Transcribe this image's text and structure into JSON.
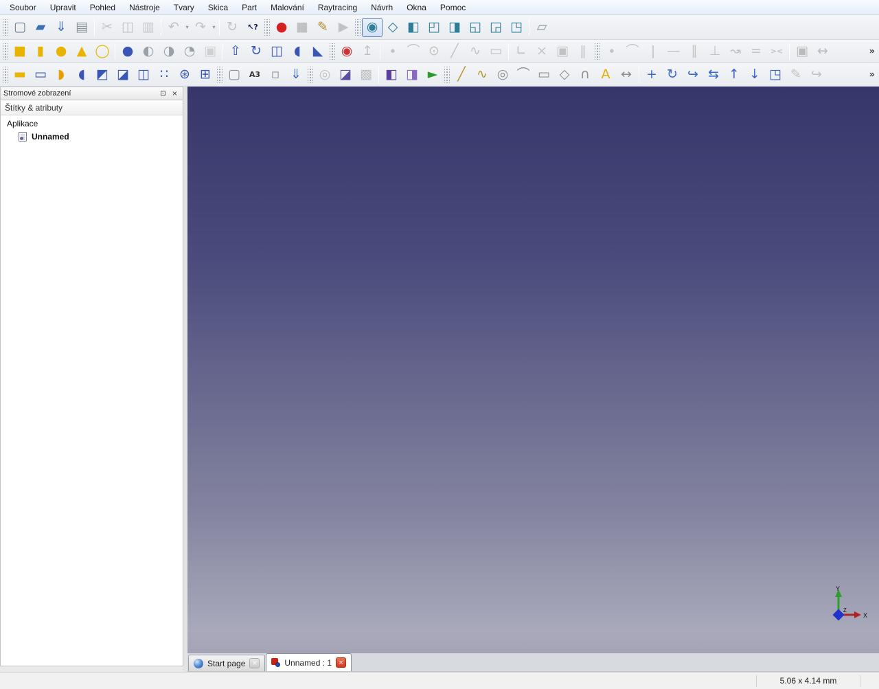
{
  "menu": {
    "items": [
      "Soubor",
      "Upravit",
      "Pohled",
      "Nástroje",
      "Tvary",
      "Skica",
      "Part",
      "Malování",
      "Raytracing",
      "Návrh",
      "Okna",
      "Pomoc"
    ]
  },
  "toolbars": {
    "row1": {
      "overflow": "",
      "groups": [
        {
          "lead": "handle",
          "items": [
            {
              "name": "new-document",
              "glyph": "▢",
              "color": "#6b7b8c"
            },
            {
              "name": "open-document",
              "glyph": "▰",
              "color": "#3f6fb5"
            },
            {
              "name": "save-document",
              "glyph": "⇓",
              "color": "#3f6fb5"
            },
            {
              "name": "print-document",
              "glyph": "▤",
              "color": "#8a929c"
            }
          ]
        },
        {
          "lead": "sep",
          "items": [
            {
              "name": "cut",
              "glyph": "✂",
              "color": "#777",
              "disabled": true
            },
            {
              "name": "copy",
              "glyph": "◫",
              "color": "#777",
              "disabled": true
            },
            {
              "name": "paste",
              "glyph": "▥",
              "color": "#9a8468",
              "disabled": true
            }
          ]
        },
        {
          "lead": "sep",
          "items": [
            {
              "name": "undo",
              "glyph": "↶",
              "color": "#777",
              "disabled": true,
              "caret": true
            },
            {
              "name": "redo",
              "glyph": "↷",
              "color": "#777",
              "disabled": true,
              "caret": true
            }
          ]
        },
        {
          "lead": "sep",
          "items": [
            {
              "name": "refresh",
              "glyph": "↻",
              "color": "#777",
              "disabled": true
            },
            {
              "name": "whats-this",
              "glyph": "↖?",
              "color": "#101a50",
              "small": true
            }
          ]
        },
        {
          "lead": "handle",
          "items": [
            {
              "name": "macro-record",
              "glyph": "●",
              "color": "#d42020"
            },
            {
              "name": "macro-stop",
              "glyph": "■",
              "color": "#777",
              "disabled": true
            },
            {
              "name": "macro-edit",
              "glyph": "✎",
              "color": "#b58a2a"
            },
            {
              "name": "macro-execute",
              "glyph": "▶",
              "color": "#777",
              "disabled": true
            }
          ]
        },
        {
          "lead": "handle",
          "items": [
            {
              "name": "view-fit-all",
              "glyph": "◉",
              "color": "#2e7d96",
              "selected": true
            },
            {
              "name": "view-axonometric",
              "glyph": "◇",
              "color": "#2e7d96"
            },
            {
              "name": "view-front",
              "glyph": "◧",
              "color": "#2e7d96"
            },
            {
              "name": "view-top",
              "glyph": "◰",
              "color": "#2e7d96"
            },
            {
              "name": "view-right",
              "glyph": "◨",
              "color": "#2e7d96"
            },
            {
              "name": "view-rear",
              "glyph": "◱",
              "color": "#2e7d96"
            },
            {
              "name": "view-bottom",
              "glyph": "◲",
              "color": "#2e7d96"
            },
            {
              "name": "view-left",
              "glyph": "◳",
              "color": "#2e7d96"
            }
          ]
        },
        {
          "lead": "sep",
          "items": [
            {
              "name": "measure-distance",
              "glyph": "▱",
              "color": "#8a929c"
            }
          ]
        }
      ]
    },
    "row2": {
      "overflow": "»",
      "groups": [
        {
          "lead": "handle",
          "items": [
            {
              "name": "part-box",
              "glyph": "■",
              "color": "#e8b400"
            },
            {
              "name": "part-cylinder",
              "glyph": "▮",
              "color": "#e8b400"
            },
            {
              "name": "part-sphere",
              "glyph": "●",
              "color": "#e8b400"
            },
            {
              "name": "part-cone",
              "glyph": "▲",
              "color": "#e8b400"
            },
            {
              "name": "part-torus",
              "glyph": "◯",
              "color": "#e8b400"
            }
          ]
        },
        {
          "lead": "sep",
          "items": [
            {
              "name": "boolean-union",
              "glyph": "●",
              "color": "#3a56b4"
            },
            {
              "name": "boolean-common",
              "glyph": "◐",
              "color": "#9aa0a8"
            },
            {
              "name": "boolean-cut",
              "glyph": "◑",
              "color": "#9aa0a8"
            },
            {
              "name": "boolean-intersection",
              "glyph": "◔",
              "color": "#9aa0a8"
            },
            {
              "name": "part-section",
              "glyph": "▣",
              "color": "#9aa0a8",
              "disabled": true
            }
          ]
        },
        {
          "lead": "sep",
          "items": [
            {
              "name": "part-extrude",
              "glyph": "⇧",
              "color": "#3a56b4"
            },
            {
              "name": "part-revolve",
              "glyph": "↻",
              "color": "#3a56b4"
            },
            {
              "name": "part-mirror",
              "glyph": "◫",
              "color": "#3a56b4"
            },
            {
              "name": "part-fillet",
              "glyph": "◖",
              "color": "#3a56b4"
            },
            {
              "name": "part-chamfer",
              "glyph": "◣",
              "color": "#3a56b4"
            }
          ]
        },
        {
          "lead": "handle",
          "items": [
            {
              "name": "sketch-new",
              "glyph": "◉",
              "color": "#cc3333"
            },
            {
              "name": "sketch-leave",
              "glyph": "↥",
              "color": "#777",
              "disabled": true
            }
          ]
        },
        {
          "lead": "sep",
          "items": [
            {
              "name": "sketch-point",
              "glyph": "∙",
              "color": "#777",
              "disabled": true
            },
            {
              "name": "sketch-arc",
              "glyph": "⌒",
              "color": "#777",
              "disabled": true
            },
            {
              "name": "sketch-circle",
              "glyph": "⊙",
              "color": "#777",
              "disabled": true
            },
            {
              "name": "sketch-line",
              "glyph": "╱",
              "color": "#777",
              "disabled": true
            },
            {
              "name": "sketch-polyline",
              "glyph": "∿",
              "color": "#777",
              "disabled": true
            },
            {
              "name": "sketch-rectangle",
              "glyph": "▭",
              "color": "#777",
              "disabled": true
            }
          ]
        },
        {
          "lead": "sep",
          "items": [
            {
              "name": "sketch-axes",
              "glyph": "∟",
              "color": "#777",
              "disabled": true
            },
            {
              "name": "sketch-trim",
              "glyph": "×",
              "color": "#777",
              "disabled": true
            },
            {
              "name": "sketch-external-geometry",
              "glyph": "▣",
              "color": "#777",
              "disabled": true
            },
            {
              "name": "sketch-construction-mode",
              "glyph": "‖",
              "color": "#777",
              "disabled": true
            }
          ]
        },
        {
          "lead": "handle",
          "items": [
            {
              "name": "constraint-coincident",
              "glyph": "∙",
              "color": "#777",
              "disabled": true
            },
            {
              "name": "constraint-point-on-object",
              "glyph": "⌒",
              "color": "#777",
              "disabled": true
            },
            {
              "name": "constraint-vertical",
              "glyph": "|",
              "color": "#777",
              "disabled": true
            },
            {
              "name": "constraint-horizontal",
              "glyph": "—",
              "color": "#777",
              "disabled": true
            },
            {
              "name": "constraint-parallel",
              "glyph": "∥",
              "color": "#777",
              "disabled": true
            },
            {
              "name": "constraint-perpendicular",
              "glyph": "⊥",
              "color": "#777",
              "disabled": true
            },
            {
              "name": "constraint-tangent",
              "glyph": "↝",
              "color": "#777",
              "disabled": true
            },
            {
              "name": "constraint-equal",
              "glyph": "=",
              "color": "#777",
              "disabled": true
            },
            {
              "name": "constraint-symmetric",
              "glyph": "><",
              "color": "#777",
              "disabled": true,
              "small": true
            }
          ]
        },
        {
          "lead": "sep",
          "items": [
            {
              "name": "constraint-lock",
              "glyph": "▣",
              "color": "#666",
              "disabled": true
            },
            {
              "name": "constraint-distance",
              "glyph": "↔",
              "color": "#666",
              "disabled": true
            }
          ]
        }
      ]
    },
    "row3": {
      "overflow": "»",
      "groups": [
        {
          "lead": "handle",
          "items": [
            {
              "name": "pd-pad",
              "glyph": "▬",
              "color": "#e8b400"
            },
            {
              "name": "pd-pocket",
              "glyph": "▭",
              "color": "#3a56b4"
            },
            {
              "name": "pd-revolution",
              "glyph": "◗",
              "color": "#e8a000"
            },
            {
              "name": "pd-groove",
              "glyph": "◖",
              "color": "#3a56b4"
            },
            {
              "name": "pd-fillet",
              "glyph": "◩",
              "color": "#3a56b4"
            },
            {
              "name": "pd-chamfer",
              "glyph": "◪",
              "color": "#3a56b4"
            },
            {
              "name": "pd-mirrored",
              "glyph": "◫",
              "color": "#3a56b4"
            },
            {
              "name": "pd-linear-pattern",
              "glyph": "∷",
              "color": "#3a56b4"
            },
            {
              "name": "pd-polar-pattern",
              "glyph": "⊛",
              "color": "#3a56b4"
            },
            {
              "name": "pd-multitransform",
              "glyph": "⊞",
              "color": "#3a56b4"
            }
          ]
        },
        {
          "lead": "handle",
          "items": [
            {
              "name": "drawing-new-page",
              "glyph": "▢",
              "color": "#8a929c"
            },
            {
              "name": "drawing-a3-landscape",
              "glyph": "A3",
              "color": "#333",
              "small": true
            },
            {
              "name": "drawing-insert-view",
              "glyph": "▫",
              "color": "#8a929c"
            },
            {
              "name": "drawing-export-page",
              "glyph": "⇓",
              "color": "#3f6fb5"
            }
          ]
        },
        {
          "lead": "handle",
          "items": [
            {
              "name": "raytracing-export-camera",
              "glyph": "◎",
              "color": "#777",
              "disabled": true
            },
            {
              "name": "raytracing-export-part",
              "glyph": "◪",
              "color": "#5a4f9f"
            },
            {
              "name": "raytracing-export-view",
              "glyph": "▩",
              "color": "#777",
              "disabled": true
            }
          ]
        },
        {
          "lead": "sep",
          "items": [
            {
              "name": "raytracing-new-project",
              "glyph": "◧",
              "color": "#5a3f9f"
            },
            {
              "name": "raytracing-insert-part",
              "glyph": "◨",
              "color": "#8868c0"
            },
            {
              "name": "raytracing-render",
              "glyph": "►",
              "color": "#2a9a2a"
            }
          ]
        },
        {
          "lead": "handle",
          "items": [
            {
              "name": "draft-line",
              "glyph": "╱",
              "color": "#b5962a"
            },
            {
              "name": "draft-wire",
              "glyph": "∿",
              "color": "#b5962a"
            },
            {
              "name": "draft-circle",
              "glyph": "◎",
              "color": "#909090"
            },
            {
              "name": "draft-arc",
              "glyph": "⌒",
              "color": "#909090"
            },
            {
              "name": "draft-rectangle",
              "glyph": "▭",
              "color": "#909090"
            },
            {
              "name": "draft-polygon",
              "glyph": "◇",
              "color": "#909090"
            },
            {
              "name": "draft-bspline",
              "glyph": "∩",
              "color": "#909090"
            },
            {
              "name": "draft-text",
              "glyph": "A",
              "color": "#e0b000"
            },
            {
              "name": "draft-dimension",
              "glyph": "↔",
              "color": "#909090"
            }
          ]
        },
        {
          "lead": "sep",
          "items": [
            {
              "name": "draft-move",
              "glyph": "+",
              "color": "#3a66c8"
            },
            {
              "name": "draft-rotate",
              "glyph": "↻",
              "color": "#3a66c8"
            },
            {
              "name": "draft-offset",
              "glyph": "↪",
              "color": "#3a66c8"
            },
            {
              "name": "draft-trimex",
              "glyph": "⇆",
              "color": "#3a66c8"
            },
            {
              "name": "draft-upgrade",
              "glyph": "↑",
              "color": "#3a66c8"
            },
            {
              "name": "draft-downgrade",
              "glyph": "↓",
              "color": "#3a66c8"
            },
            {
              "name": "draft-scale",
              "glyph": "◳",
              "color": "#3a66c8"
            },
            {
              "name": "draft-edit",
              "glyph": "✎",
              "color": "#777",
              "disabled": true
            },
            {
              "name": "draft-wire-to-bspline",
              "glyph": "↪",
              "color": "#777",
              "disabled": true
            }
          ]
        }
      ]
    }
  },
  "tree_panel": {
    "title": "Stromové zobrazení",
    "float_icon": "⊡",
    "close_icon": "×",
    "column_header": "Štítky & atributy",
    "root_label": "Aplikace",
    "document_label": "Unnamed"
  },
  "viewport": {
    "gradient_top": "#36366a",
    "gradient_bottom": "#a9a9bb",
    "axis": {
      "x_label": "X",
      "y_label": "Y",
      "z_label": "Z",
      "x_color": "#b22222",
      "y_color": "#2ca02c",
      "z_color": "#2233cc"
    }
  },
  "mdi_tabs": {
    "start_page": {
      "label": "Start page",
      "close": "×"
    },
    "document": {
      "label": "Unnamed : 1",
      "close": "×"
    }
  },
  "status_bar": {
    "dimensions": "5.06 x 4.14 mm"
  }
}
